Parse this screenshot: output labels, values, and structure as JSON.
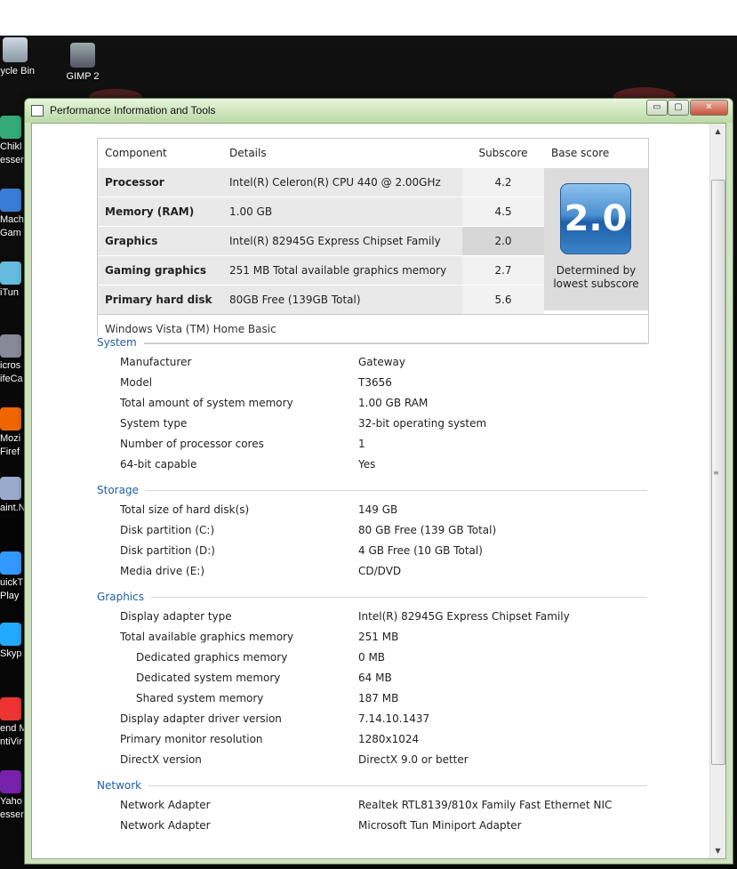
{
  "desktop": {
    "icons": [
      {
        "label": "cycle Bin",
        "icon": "recycle-bin-icon"
      },
      {
        "label": "GIMP 2",
        "icon": "gimp-icon"
      }
    ],
    "left_icons": [
      {
        "lines": [
          "Chikl",
          "esser"
        ],
        "icon": "shortcut-icon"
      },
      {
        "lines": [
          "Mach",
          "Gam"
        ],
        "icon": "shortcut-icon"
      },
      {
        "lines": [
          "iTun"
        ],
        "icon": "itunes-icon"
      },
      {
        "lines": [
          "icros",
          "ifeCa"
        ],
        "icon": "webcam-icon"
      },
      {
        "lines": [
          "Mozi",
          "Firef"
        ],
        "icon": "firefox-icon"
      },
      {
        "lines": [
          "aint.N"
        ],
        "icon": "paint-icon"
      },
      {
        "lines": [
          "uickT",
          "Play"
        ],
        "icon": "quicktime-icon"
      },
      {
        "lines": [
          "Skyp"
        ],
        "icon": "skype-icon"
      },
      {
        "lines": [
          "end M",
          "ntiVir"
        ],
        "icon": "antivirus-icon"
      },
      {
        "lines": [
          "Yaho",
          "esser"
        ],
        "icon": "yahoo-icon"
      }
    ]
  },
  "window": {
    "title": "Performance Information and Tools",
    "controls": {
      "minimize": "▭",
      "maximize": "▢",
      "close": "✕"
    }
  },
  "score_table": {
    "headers": [
      "Component",
      "Details",
      "Subscore",
      "Base score"
    ],
    "rows": [
      {
        "component": "Processor",
        "details": "Intel(R) Celeron(R) CPU 440 @ 2.00GHz",
        "subscore": "4.2"
      },
      {
        "component": "Memory (RAM)",
        "details": "1.00 GB",
        "subscore": "4.5"
      },
      {
        "component": "Graphics",
        "details": "Intel(R) 82945G Express Chipset Family",
        "subscore": "2.0"
      },
      {
        "component": "Gaming graphics",
        "details": "251 MB Total available graphics memory",
        "subscore": "2.7"
      },
      {
        "component": "Primary hard disk",
        "details": "80GB Free (139GB Total)",
        "subscore": "5.6"
      }
    ],
    "base_score": "2.0",
    "base_note_line1": "Determined by",
    "base_note_line2": "lowest subscore",
    "os": "Windows Vista (TM) Home Basic"
  },
  "sections": [
    {
      "title": "System",
      "rows": [
        {
          "key": "Manufacturer",
          "value": "Gateway"
        },
        {
          "key": "Model",
          "value": "T3656"
        },
        {
          "key": "Total amount of system memory",
          "value": "1.00 GB RAM"
        },
        {
          "key": "System type",
          "value": "32-bit operating system"
        },
        {
          "key": "Number of processor cores",
          "value": "1"
        },
        {
          "key": "64-bit capable",
          "value": "Yes"
        }
      ]
    },
    {
      "title": "Storage",
      "rows": [
        {
          "key": "Total size of hard disk(s)",
          "value": "149 GB"
        },
        {
          "key": "Disk partition (C:)",
          "value": "80 GB Free (139 GB Total)"
        },
        {
          "key": "Disk partition (D:)",
          "value": "4 GB Free (10 GB Total)"
        },
        {
          "key": "Media drive (E:)",
          "value": "CD/DVD"
        }
      ]
    },
    {
      "title": "Graphics",
      "rows": [
        {
          "key": "Display adapter type",
          "value": "Intel(R) 82945G Express Chipset Family"
        },
        {
          "key": "Total available graphics memory",
          "value": "251 MB"
        },
        {
          "key": "Dedicated graphics memory",
          "value": "0 MB",
          "indent": true
        },
        {
          "key": "Dedicated system memory",
          "value": "64 MB",
          "indent": true
        },
        {
          "key": "Shared system memory",
          "value": "187 MB",
          "indent": true
        },
        {
          "key": "Display adapter driver version",
          "value": "7.14.10.1437"
        },
        {
          "key": "Primary monitor resolution",
          "value": "1280x1024"
        },
        {
          "key": "DirectX version",
          "value": "DirectX 9.0 or better"
        }
      ]
    },
    {
      "title": "Network",
      "rows": [
        {
          "key": "Network Adapter",
          "value": "Realtek RTL8139/810x Family Fast Ethernet NIC"
        },
        {
          "key": "Network Adapter",
          "value": "Microsoft Tun Miniport Adapter"
        }
      ]
    }
  ],
  "colors": {
    "section_title": "#1f5fa8",
    "badge": "#2e74bf",
    "window_frame": "#cfe3c0"
  }
}
